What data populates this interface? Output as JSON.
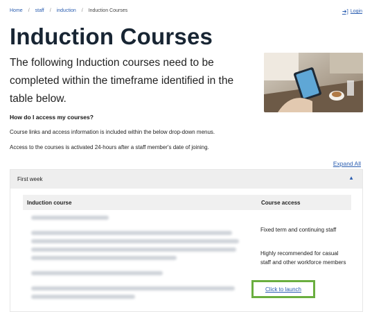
{
  "breadcrumb": {
    "home": "Home",
    "staff": "staff",
    "induction": "induction",
    "current": "Induction Courses"
  },
  "login_label": "Login",
  "page_title": "Induction Courses",
  "intro_text": "The following Induction courses need to be completed within the timeframe identified in the table below.",
  "faq": {
    "heading": "How do I access my courses?",
    "line1": "Course links and access information is included within the below drop-down menus.",
    "line2": "Access to the courses is activated 24-hours after a staff member's date of joining."
  },
  "expand_all": "Expand All",
  "accordion": {
    "title": "First week",
    "table": {
      "headers": [
        "Induction course",
        "Course access"
      ],
      "access_1": "Fixed term and continuing staff",
      "access_2": "Highly recommended for casual staff and other workforce members",
      "launch_label": "Click to launch"
    }
  },
  "icons": {
    "login": "login-arrow-icon",
    "chevron": "chevron-up-icon"
  },
  "colors": {
    "link": "#2a5db0",
    "highlight": "#6aae3f",
    "title": "#182533"
  }
}
